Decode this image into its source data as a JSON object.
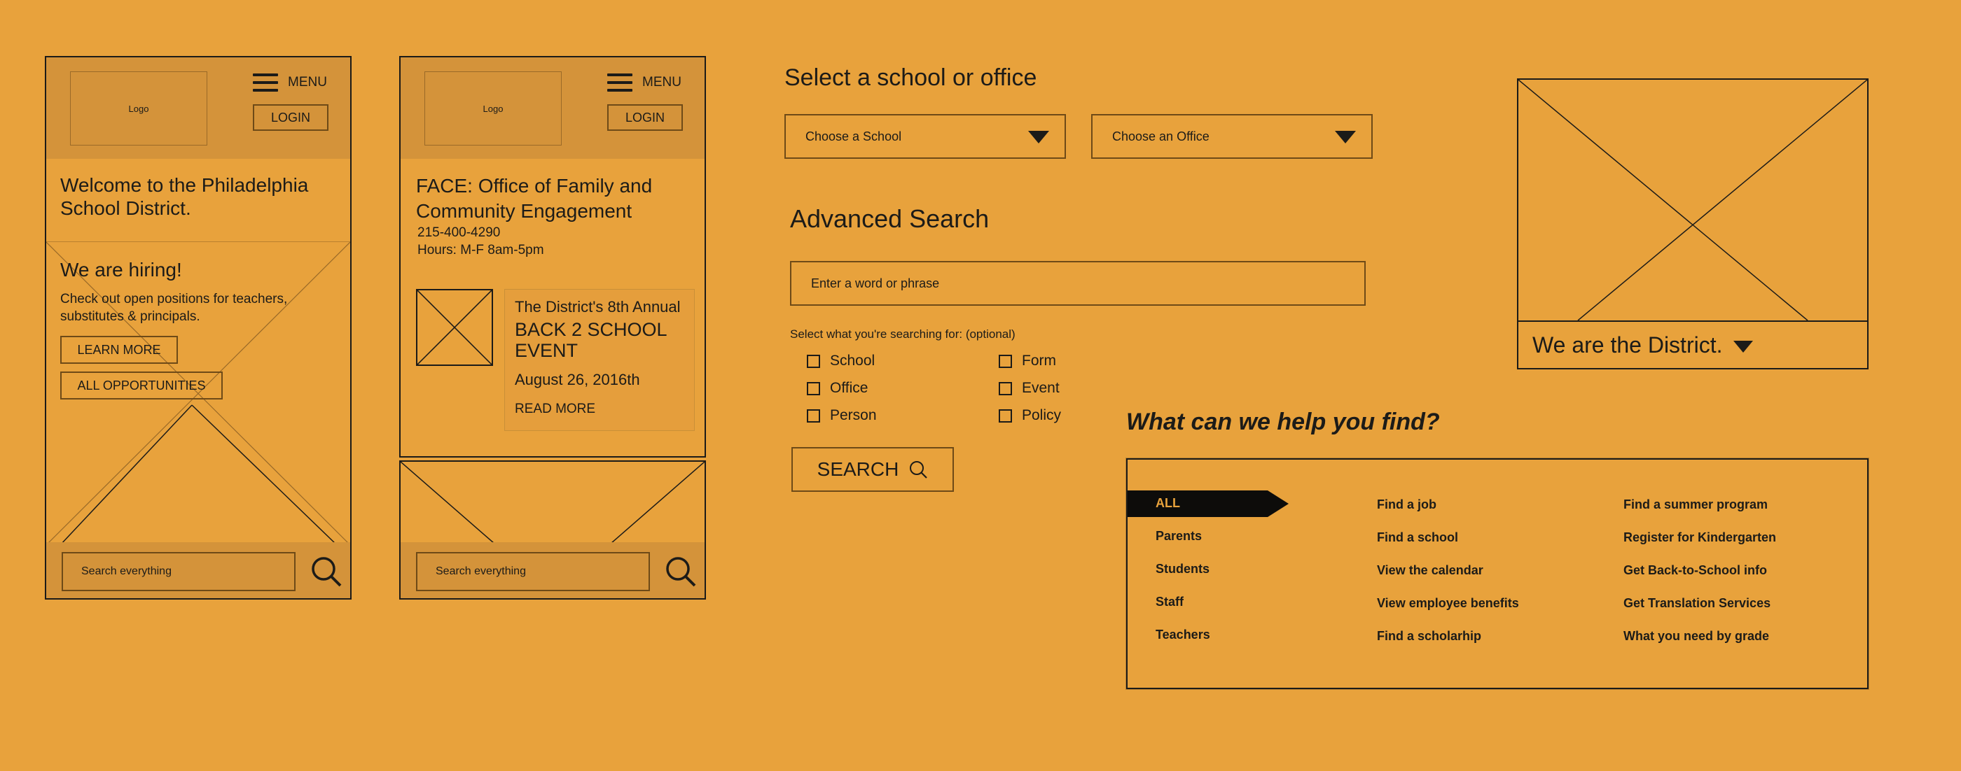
{
  "phone1": {
    "logo": "Logo",
    "menu_label": "MENU",
    "login_label": "LOGIN",
    "welcome": "Welcome to the Philadelphia School District.",
    "hiring_title": "We are hiring!",
    "hiring_text": "Check out open positions for teachers, substitutes & principals.",
    "learn_more": "LEARN MORE",
    "all_opportunities": "ALL OPPORTUNITIES",
    "search_placeholder": "Search everything"
  },
  "phone2": {
    "logo": "Logo",
    "menu_label": "MENU",
    "login_label": "LOGIN",
    "office_title": "FACE: Office of Family and Community Engagement",
    "phone": "215-400-4290",
    "hours": "Hours: M-F 8am-5pm",
    "event_intro": "The District's 8th Annual",
    "event_title": "BACK 2 SCHOOL EVENT",
    "event_date": "August 26, 2016th",
    "read_more": "READ MORE",
    "search_placeholder": "Search everything"
  },
  "select_section": {
    "title": "Select a school or office",
    "school_dropdown": "Choose a School",
    "office_dropdown": "Choose an Office"
  },
  "advanced_search": {
    "title": "Advanced Search",
    "input_placeholder": "Enter a word or phrase",
    "filter_label": "Select what you're searching for: (optional)",
    "options_left": [
      "School",
      "Office",
      "Person"
    ],
    "options_right": [
      "Form",
      "Event",
      "Policy"
    ],
    "search_button": "SEARCH"
  },
  "hero": {
    "caption": "We are the District."
  },
  "help_finder": {
    "title": "What can we help you find?",
    "active_category": "ALL",
    "categories": [
      "Parents",
      "Students",
      "Staff",
      "Teachers"
    ],
    "links_col1": [
      "Find a job",
      "Find a school",
      "View the calendar",
      "View employee benefits",
      "Find a scholarhip"
    ],
    "links_col2": [
      "Find a summer program",
      "Register for Kindergarten",
      "Get Back-to-School info",
      "Get Translation Services",
      "What you need by grade"
    ]
  }
}
